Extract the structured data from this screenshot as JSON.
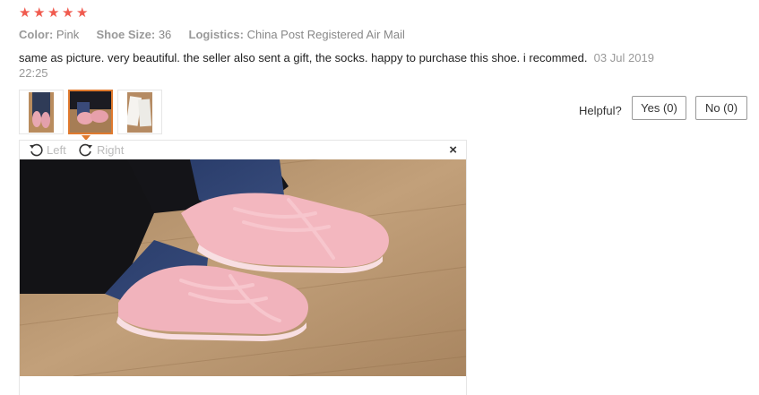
{
  "rating": {
    "stars": 5,
    "color": "#f05b4f",
    "icon": "star-icon"
  },
  "attributes": [
    {
      "key": "Color:",
      "value": "Pink"
    },
    {
      "key": "Shoe Size:",
      "value": "36"
    },
    {
      "key": "Logistics:",
      "value": "China Post Registered Air Mail"
    }
  ],
  "review": {
    "text": "same as picture. very beautiful. the seller also sent a gift, the socks. happy to purchase this shoe. i recommed.",
    "date_part1": "03 Jul",
    "date_part2": "2019 22:25"
  },
  "thumbnails": [
    {
      "name": "thumbnail-1",
      "active": false
    },
    {
      "name": "thumbnail-2",
      "active": true
    },
    {
      "name": "thumbnail-3",
      "active": false
    }
  ],
  "helpful": {
    "label": "Helpful?",
    "yes": "Yes (0)",
    "no": "No (0)"
  },
  "viewer": {
    "rotate_left": "Left",
    "rotate_right": "Right",
    "close": "×",
    "icons": [
      "rotate-left-icon",
      "rotate-right-icon",
      "close-icon"
    ]
  },
  "accent_color": "#e07a2e"
}
